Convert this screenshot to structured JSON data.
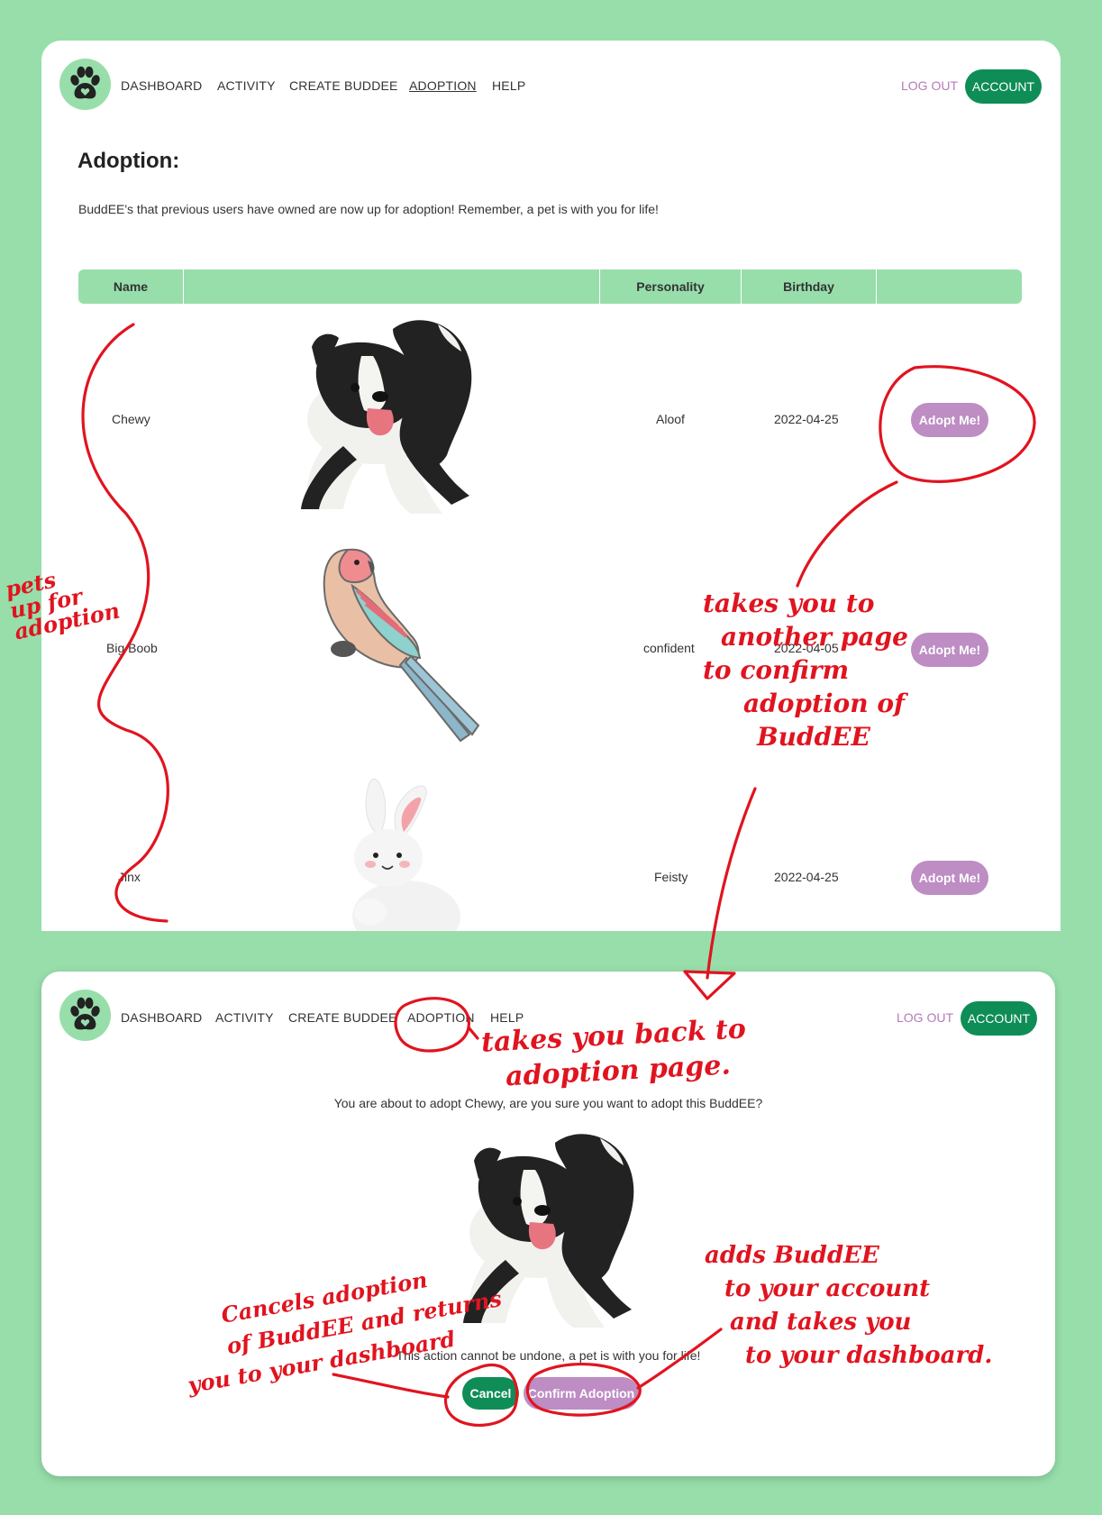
{
  "nav": {
    "links": [
      "DASHBOARD",
      "ACTIVITY",
      "CREATE BUDDEE",
      "ADOPTION",
      "HELP"
    ],
    "logout": "LOG OUT",
    "account": "ACCOUNT"
  },
  "adoption_page": {
    "title": "Adoption:",
    "intro": "BuddEE's that previous users have owned are now up for adoption! Remember, a pet is with you for life!",
    "columns": [
      "Name",
      "",
      "Personality",
      "Birthday",
      ""
    ],
    "pets": [
      {
        "name": "Chewy",
        "image": "border-collie-dog",
        "personality": "Aloof",
        "birthday": "2022-04-25",
        "action": "Adopt Me!"
      },
      {
        "name": "Big Boob",
        "image": "pink-parrot",
        "personality": "confident",
        "birthday": "2022-04-05",
        "action": "Adopt Me!"
      },
      {
        "name": "Jinx",
        "image": "white-bunny",
        "personality": "Feisty",
        "birthday": "2022-04-25",
        "action": "Adopt Me!"
      }
    ]
  },
  "confirm_page": {
    "question": "You are about to adopt Chewy, are you sure you want to adopt this BuddEE?",
    "image": "border-collie-dog",
    "warning": "This action cannot be undone, a pet is with you for life!",
    "cancel": "Cancel",
    "confirm": "Confirm Adoption"
  },
  "annotations": {
    "pets_up_for_adoption": [
      "pets",
      "up for",
      "adoption"
    ],
    "adopt_note": [
      "takes you to",
      "another page",
      "to confirm",
      "adoption of",
      "BuddEE"
    ],
    "back_note": [
      "takes you back to",
      "adoption page."
    ],
    "cancel_note": [
      "Cancels adoption",
      "of BuddEE and returns",
      "you to your dashboard"
    ],
    "confirm_note": [
      "adds BuddEE",
      "to your account",
      "and takes you",
      "to your dashboard."
    ],
    "ink_color": "#e0141f"
  }
}
